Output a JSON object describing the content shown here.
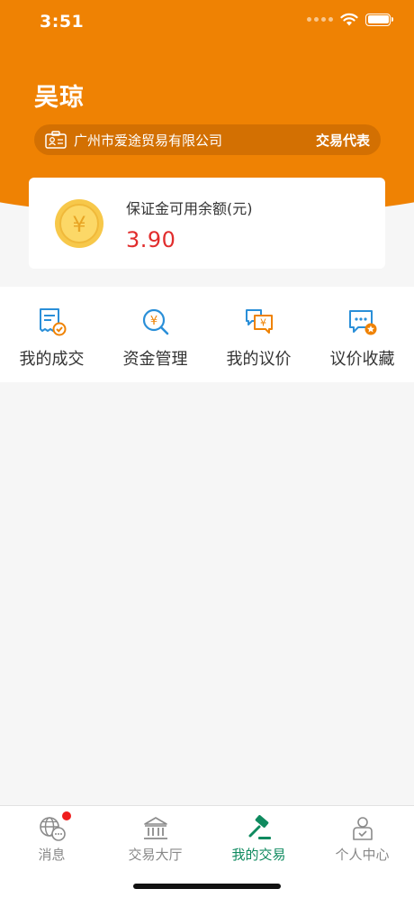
{
  "status_bar": {
    "time": "3:51"
  },
  "user": {
    "name": "吴琼"
  },
  "company": {
    "name": "广州市爱途贸易有限公司",
    "role": "交易代表"
  },
  "balance": {
    "label": "保证金可用余额(元)",
    "value": "3.90",
    "currency_symbol": "¥"
  },
  "actions": [
    {
      "label": "我的成交",
      "icon": "deal-receipt-icon"
    },
    {
      "label": "资金管理",
      "icon": "fund-search-icon"
    },
    {
      "label": "我的议价",
      "icon": "negotiation-chat-icon"
    },
    {
      "label": "议价收藏",
      "icon": "favorite-chat-icon"
    }
  ],
  "tabs": [
    {
      "label": "消息",
      "icon": "globe-chat-icon",
      "active": false,
      "badge": true
    },
    {
      "label": "交易大厅",
      "icon": "bank-building-icon",
      "active": false,
      "badge": false
    },
    {
      "label": "我的交易",
      "icon": "gavel-icon",
      "active": true,
      "badge": false
    },
    {
      "label": "个人中心",
      "icon": "person-icon",
      "active": false,
      "badge": false
    }
  ],
  "colors": {
    "brand_orange": "#ef8203",
    "balance_red": "#e12d2d",
    "active_tab_green": "#0f8a5f",
    "icon_blue": "#2a8fd8"
  }
}
